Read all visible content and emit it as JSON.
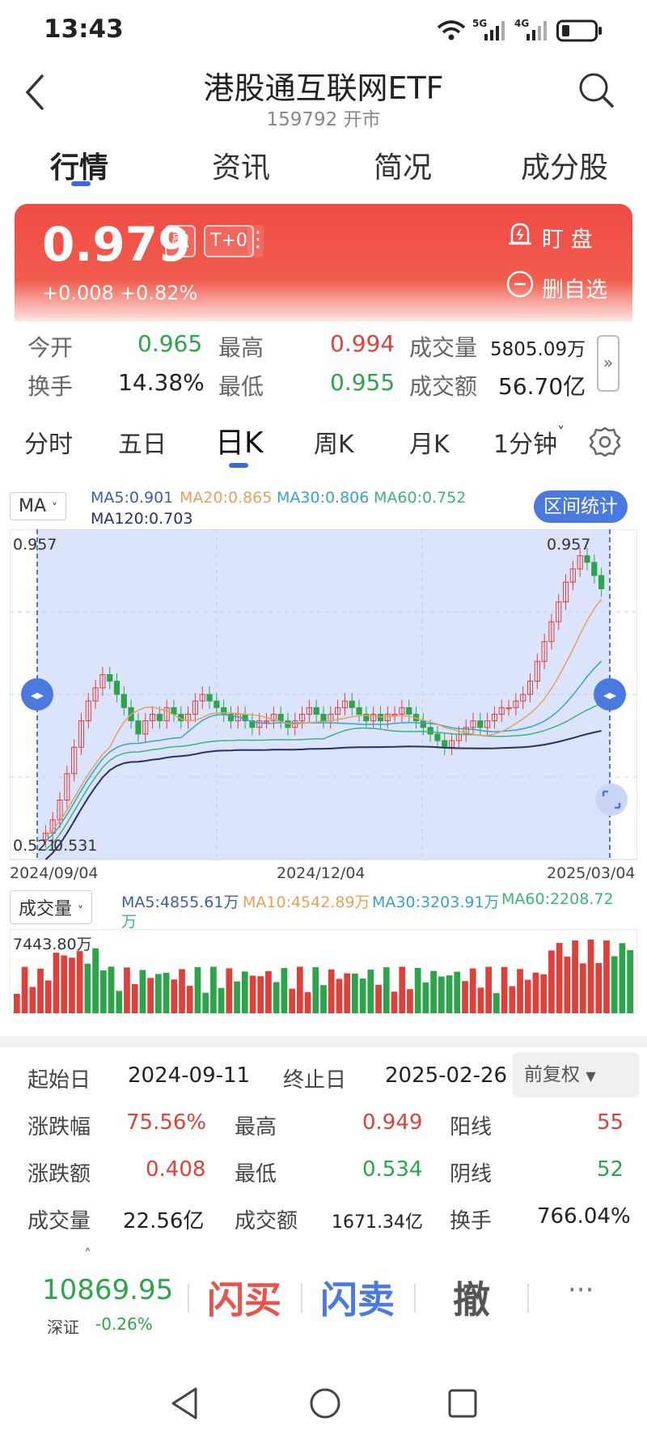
{
  "status": {
    "time": "13:43",
    "signal1": "5G",
    "signal2": "4G"
  },
  "header": {
    "title": "港股通互联网ETF",
    "subtitle": "159792 开市"
  },
  "tabs": [
    "行情",
    "资讯",
    "简况",
    "成分股"
  ],
  "price": {
    "value": "0.979",
    "change": "+0.008",
    "change_pct": "+0.82%",
    "badge_margin": "融",
    "badge_t0": "T+0",
    "watch_label": "盯  盘",
    "remove_label": "删自选",
    "color": "#ef4b44"
  },
  "quote": {
    "open_label": "今开",
    "open": "0.965",
    "high_label": "最高",
    "high": "0.994",
    "volume_label": "成交量",
    "volume": "5805.09万",
    "turnover_label": "换手",
    "turnover": "14.38%",
    "low_label": "最低",
    "low": "0.955",
    "amount_label": "成交额",
    "amount": "56.70亿"
  },
  "periods": [
    "分时",
    "五日",
    "日K",
    "周K",
    "月K",
    "1分钟"
  ],
  "ma_bar": {
    "selector": "MA",
    "ma5": "MA5:0.901",
    "ma20": "MA20:0.865",
    "ma30": "MA30:0.806",
    "ma60": "MA60:0.752",
    "ma120": "MA120:0.703",
    "range_button": "区间统计"
  },
  "chart_data": {
    "type": "candlestick",
    "price_high_label": "0.957",
    "price_high_label_right": "0.957",
    "price_low_label": "0.521",
    "price_low_label2": "0.531",
    "x_ticks": [
      "2024/09/04",
      "2024/12/04",
      "2025/03/04"
    ],
    "ylim": [
      0.49,
      0.99
    ],
    "close_series": [
      0.53,
      0.55,
      0.58,
      0.62,
      0.66,
      0.7,
      0.73,
      0.75,
      0.77,
      0.76,
      0.74,
      0.72,
      0.7,
      0.68,
      0.7,
      0.71,
      0.7,
      0.72,
      0.71,
      0.7,
      0.71,
      0.73,
      0.74,
      0.73,
      0.72,
      0.71,
      0.7,
      0.71,
      0.7,
      0.69,
      0.7,
      0.7,
      0.71,
      0.7,
      0.69,
      0.7,
      0.71,
      0.72,
      0.71,
      0.7,
      0.71,
      0.72,
      0.73,
      0.72,
      0.71,
      0.7,
      0.71,
      0.7,
      0.71,
      0.71,
      0.72,
      0.71,
      0.7,
      0.69,
      0.68,
      0.67,
      0.66,
      0.67,
      0.68,
      0.69,
      0.7,
      0.69,
      0.7,
      0.71,
      0.72,
      0.72,
      0.73,
      0.74,
      0.76,
      0.79,
      0.82,
      0.85,
      0.88,
      0.91,
      0.93,
      0.95,
      0.94,
      0.92,
      0.9
    ],
    "volume_label": "成交量",
    "volume_max_label": "7443.80万",
    "vol_ma5": "MA5:4855.61万",
    "vol_ma10": "MA10:4542.89万",
    "vol_ma30": "MA30:3203.91万",
    "vol_ma60": "MA60:2208.72",
    "vol_ma60_unit": "万"
  },
  "stats": {
    "start_label": "起始日",
    "start": "2024-09-11",
    "end_label": "终止日",
    "end": "2025-02-26",
    "adjust": "前复权",
    "pct_label": "涨跌幅",
    "pct": "75.56%",
    "high_label": "最高",
    "high": "0.949",
    "up_label": "阳线",
    "up": "55",
    "amt_label": "涨跌额",
    "amt": "0.408",
    "low_label": "最低",
    "low": "0.534",
    "down_label": "阴线",
    "down": "52",
    "vol_label": "成交量",
    "vol": "22.56亿",
    "value_label": "成交额",
    "value": "1671.34亿",
    "turn_label": "换手",
    "turn": "766.04%"
  },
  "bottom": {
    "index_value": "10869.95",
    "index_name": "深证",
    "index_chg": "-0.26%",
    "buy": "闪买",
    "sell": "闪卖",
    "cancel": "撤",
    "more": "···"
  }
}
